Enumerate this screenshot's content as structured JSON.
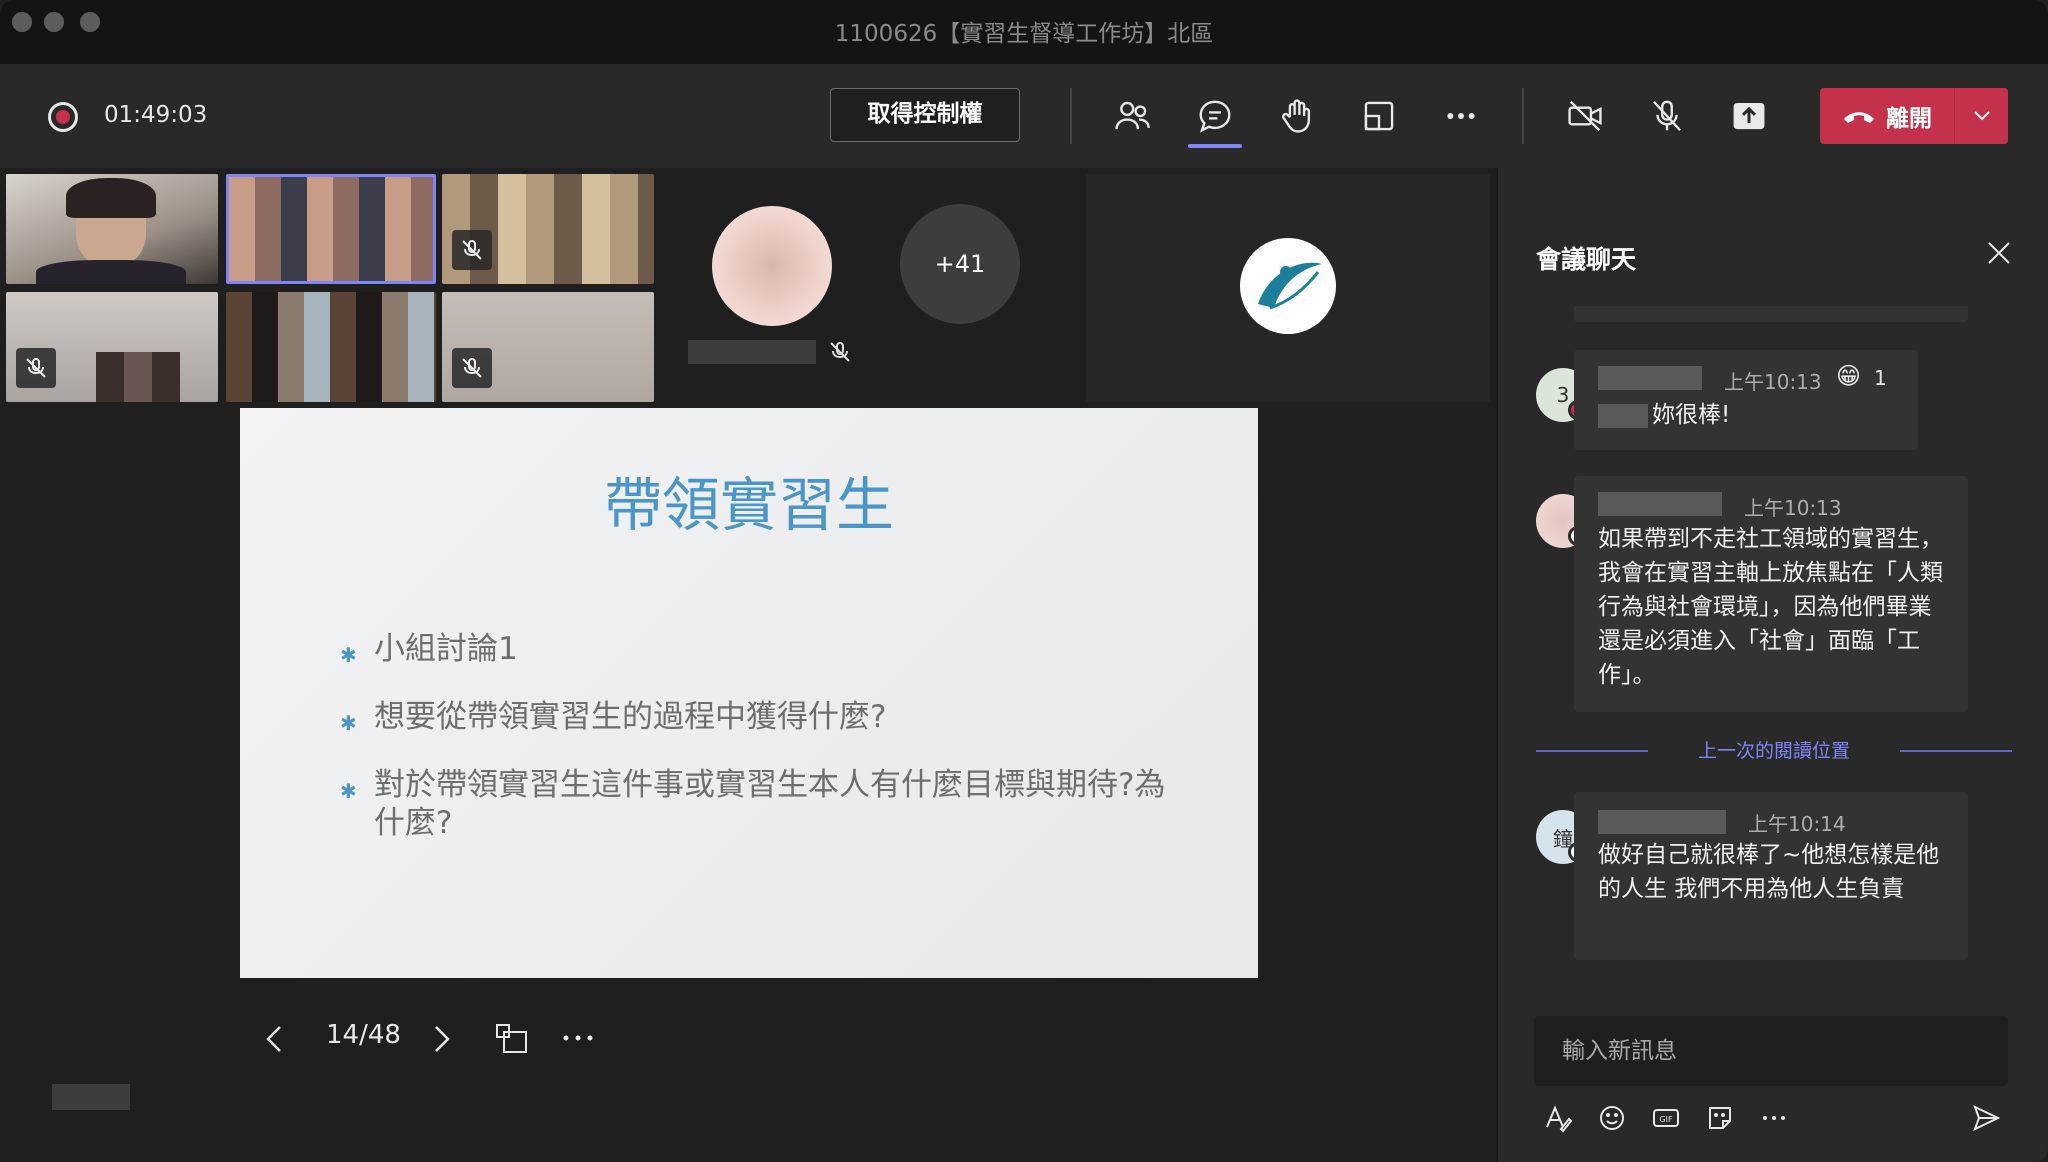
{
  "window": {
    "title": "1100626【實習生督導工作坊】北區"
  },
  "toolbar": {
    "timer": "01:49:03",
    "take_control_label": "取得控制權",
    "leave_label": "離開",
    "icons": [
      "people-icon",
      "chat-icon",
      "raise-hand-icon",
      "rooms-icon",
      "more-icon",
      "camera-off-icon",
      "mic-off-icon",
      "share-icon"
    ]
  },
  "participants": {
    "overflow_count": "+41"
  },
  "slide": {
    "title": "帶領實習生",
    "bullets": [
      "小組討論1",
      "想要從帶領實習生的過程中獲得什麼?",
      "對於帶領實習生這件事或實習生本人有什麼目標與期待?為什麼?"
    ],
    "page": "14/48"
  },
  "chat": {
    "title": "會議聊天",
    "messages": [
      {
        "avatar_initial": "3",
        "time": "上午10:13",
        "reaction_emoji": "😁",
        "reaction_count": "1",
        "text": "妳很棒!"
      },
      {
        "avatar_initial": "",
        "time": "上午10:13",
        "text": "如果帶到不走社工領域的實習生，我會在實習主軸上放焦點在「人類行為與社會環境」，因為他們畢業還是必須進入「社會」面臨「工作」。"
      },
      {
        "avatar_initial": "鐘",
        "time": "上午10:14",
        "text": "做好自己就很棒了~他想怎樣是他的人生  我們不用為他人生負責"
      }
    ],
    "read_marker": "上一次的閱讀位置",
    "compose_placeholder": "輸入新訊息"
  },
  "colors": {
    "accent": "#7f85f5",
    "leave": "#c4314b",
    "slide_title": "#4a96c8"
  }
}
